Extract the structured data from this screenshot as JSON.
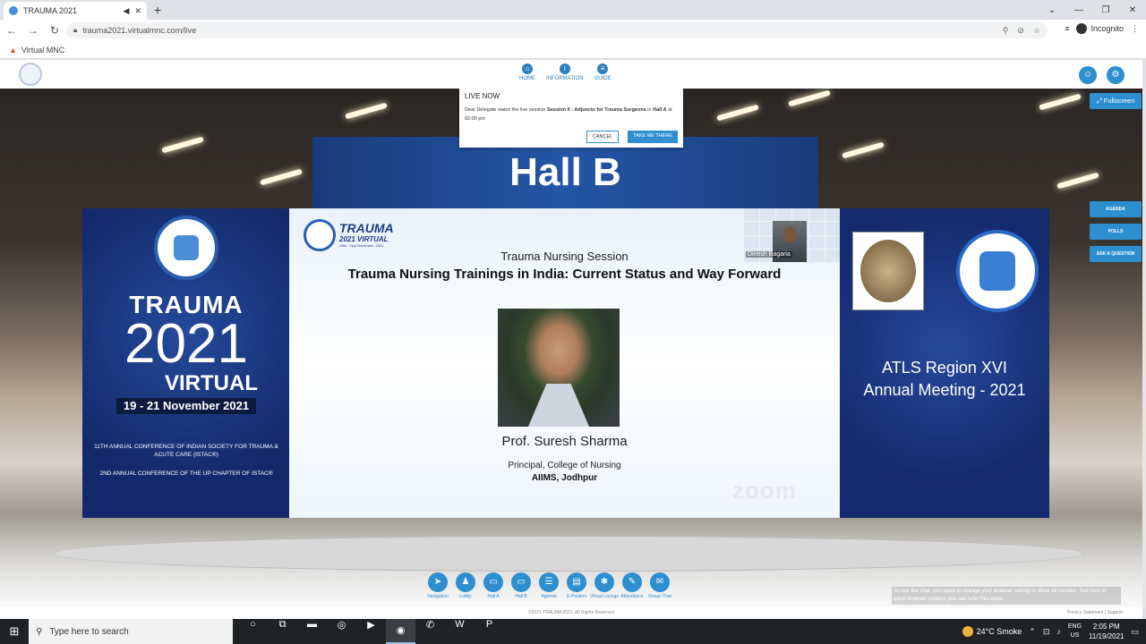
{
  "browser": {
    "tab_title": "TRAUMA 2021",
    "url": "trauma2021.virtualmnc.com/live",
    "bookmark": "Virtual MNC",
    "incognito_label": "Incognito"
  },
  "app_nav": [
    {
      "label": "HOME",
      "icon": "home-icon"
    },
    {
      "label": "INFORMATION",
      "icon": "info-icon"
    },
    {
      "label": "GUIDE",
      "icon": "guide-icon"
    }
  ],
  "fullscreen_label": "Fullscreen",
  "popup": {
    "title": "LIVE NOW",
    "message_pre": "Dear Delegate watch the live session ",
    "session": "Session II : Adjuncts for Trauma Surgeons",
    "message_mid": " in ",
    "hall": "Hall A",
    "message_post": " at 02:00 pm",
    "cancel_label": "CANCEL",
    "take_label": "TAKE ME THERE"
  },
  "hall_title": "Hall B",
  "left_panel": {
    "t1": "TRAUMA",
    "t2": "2021",
    "t3": "VIRTUAL",
    "dates": "19 - 21 November 2021",
    "line1": "11TH ANNUAL CONFERENCE OF INDIAN SOCIETY FOR TRAUMA & ACUTE CARE (ISTAC®)",
    "line2": "2ND ANNUAL CONFERENCE OF THE UP CHAPTER OF ISTAC®"
  },
  "right_panel": {
    "line1": "ATLS Region XVI",
    "line2": "Annual Meeting - 2021"
  },
  "slide": {
    "brand1": "TRAUMA",
    "brand2": "2021 VIRTUAL",
    "brand3": "19th - 21st November, 2021",
    "session": "Trauma Nursing Session",
    "title": "Trauma Nursing Trainings in India: Current Status and Way Forward",
    "speaker": "Prof. Suresh Sharma",
    "role": "Principal, College of Nursing",
    "institute": "AIIMS, Jodhpur",
    "zoom_mark": "zoom",
    "cam_name": "Dinesh Bagaria"
  },
  "side_buttons": [
    "AGENDA",
    "POLLS",
    "ASK A QUESTION"
  ],
  "bottom_nav": [
    {
      "label": "Navigation",
      "icon": "navigation-icon"
    },
    {
      "label": "Lobby",
      "icon": "lobby-icon"
    },
    {
      "label": "Hall A",
      "icon": "hall-a-icon"
    },
    {
      "label": "Hall B",
      "icon": "hall-b-icon"
    },
    {
      "label": "Agenda",
      "icon": "agenda-icon"
    },
    {
      "label": "E-Posters",
      "icon": "e-posters-icon"
    },
    {
      "label": "Virtual Lounge",
      "icon": "lounge-icon"
    },
    {
      "label": "Attendance",
      "icon": "attendance-icon"
    },
    {
      "label": "Group Chat",
      "icon": "group-chat-icon"
    }
  ],
  "chat_note": "To use the chat, you need to change your browser setting to allow all cookies. See how to allow browser cookies you can refer this video",
  "footer": {
    "copyright": "©2021 TRAUMA 2021. All Rights Reserved",
    "privacy": "Privacy Statement  |  Support"
  },
  "taskbar": {
    "search_placeholder": "Type here to search",
    "weather": "24°C  Smoke",
    "lang1": "ENG",
    "lang2": "US",
    "time": "2:05 PM",
    "date": "11/19/2021"
  }
}
